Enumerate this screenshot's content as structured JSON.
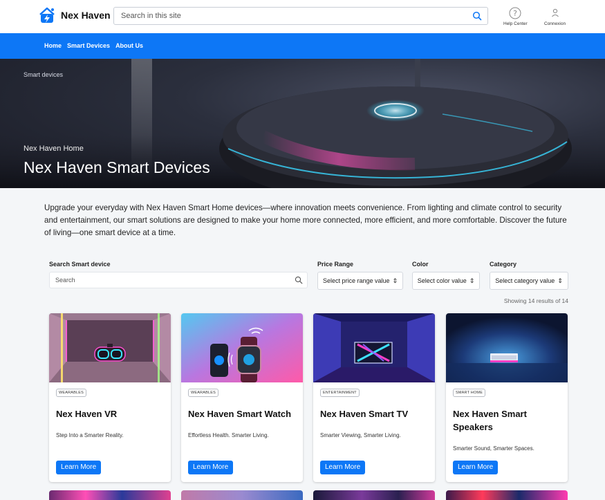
{
  "brand": {
    "name": "Nex Haven"
  },
  "search": {
    "placeholder": "Search in this site"
  },
  "header_links": [
    {
      "label": "Help Center",
      "icon": "help-circle-icon"
    },
    {
      "label": "Connexion",
      "icon": "user-icon"
    }
  ],
  "nav": {
    "items": [
      "Home",
      "Smart Devices",
      "About Us"
    ]
  },
  "hero": {
    "breadcrumb": "Smart devices",
    "eyebrow": "Nex Haven Home",
    "title": "Nex Haven Smart Devices"
  },
  "intro": "Upgrade your everyday with Nex Haven Smart Home devices—where innovation meets convenience. From lighting and climate control to security and entertainment, our smart solutions are designed to make your home more connected, more efficient, and more comfortable. Discover the future of living—one smart device at a time.",
  "filters": {
    "search_label": "Search Smart device",
    "search_placeholder": "Search",
    "price_label": "Price Range",
    "price_value": "Select price range value",
    "color_label": "Color",
    "color_value": "Select color value",
    "category_label": "Category",
    "category_value": "Select category value"
  },
  "results_text": "Showing 14 results of 14",
  "products": [
    {
      "tag": "WEARABLES",
      "title": "Nex Haven VR",
      "description": "Step Into a Smarter Reality.",
      "button": "Learn More"
    },
    {
      "tag": "WEARABLES",
      "title": "Nex Haven Smart Watch",
      "description": "Effortless Health. Smarter Living.",
      "button": "Learn More"
    },
    {
      "tag": "ENTERTAINMENT",
      "title": "Nex Haven Smart TV",
      "description": "Smarter Viewing, Smarter Living.",
      "button": "Learn More"
    },
    {
      "tag": "SMART HOME",
      "title": "Nex Haven Smart Speakers",
      "description": "Smarter Sound, Smarter Spaces.",
      "button": "Learn More"
    }
  ],
  "colors": {
    "accent": "#0d77f6",
    "page_bg": "#f4f6f8"
  }
}
